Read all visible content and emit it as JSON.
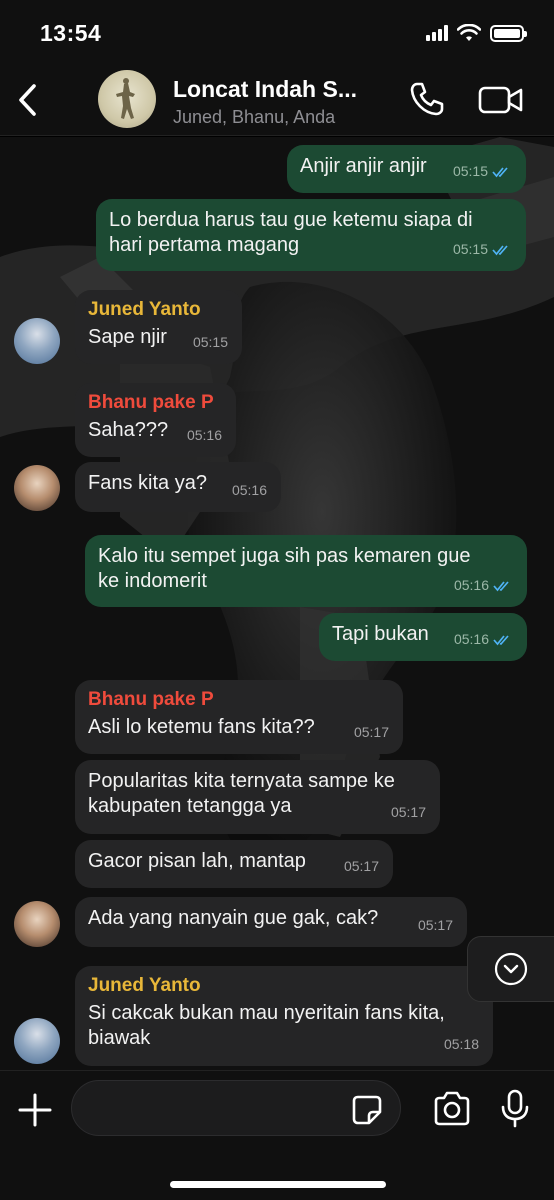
{
  "status_bar": {
    "time": "13:54"
  },
  "header": {
    "group_name": "Loncat Indah S...",
    "members": "Juned, Bhanu, Anda"
  },
  "messages": [
    {
      "dir": "out",
      "text": "Anjir anjir anjir",
      "time": "05:15"
    },
    {
      "dir": "out",
      "text": "Lo berdua harus tau gue ketemu siapa di\nhari pertama magang",
      "time": "05:15"
    },
    {
      "dir": "in",
      "sender": "Juned Yanto",
      "text": "Sape njir",
      "time": "05:15"
    },
    {
      "dir": "in",
      "sender": "Bhanu pake P",
      "text": "Saha???",
      "time": "05:16"
    },
    {
      "dir": "in",
      "text": "Fans kita ya?",
      "time": "05:16"
    },
    {
      "dir": "out",
      "text": "Kalo itu sempet juga sih pas kemaren gue\nke indomerit",
      "time": "05:16"
    },
    {
      "dir": "out",
      "text": "Tapi bukan",
      "time": "05:16"
    },
    {
      "dir": "in",
      "sender": "Bhanu pake P",
      "text": "Asli lo ketemu fans kita??",
      "time": "05:17"
    },
    {
      "dir": "in",
      "text": "Popularitas kita ternyata sampe ke\nkabupaten tetangga ya",
      "time": "05:17"
    },
    {
      "dir": "in",
      "text": "Gacor pisan lah, mantap",
      "time": "05:17"
    },
    {
      "dir": "in",
      "text": "Ada yang nanyain gue gak, cak?",
      "time": "05:17"
    },
    {
      "dir": "in",
      "sender": "Juned Yanto",
      "text": "Si cakcak bukan mau nyeritain fans kita,\nbiawak",
      "time": "05:18"
    }
  ],
  "composer": {
    "placeholder": ""
  },
  "colors": {
    "outgoing_bubble": "#1c4a33",
    "incoming_bubble": "#252526",
    "juned_name": "#e8b739",
    "bhanu_name": "#ef4b3c",
    "read_tick": "#4fb3f6"
  },
  "icons": {
    "back": "chevron-left-icon",
    "call": "phone-icon",
    "video": "video-camera-icon",
    "scroll_down": "chevron-down-circle-icon",
    "add": "plus-icon",
    "sticker": "sticker-icon",
    "camera": "camera-icon",
    "mic": "microphone-icon",
    "read": "double-check-icon"
  }
}
